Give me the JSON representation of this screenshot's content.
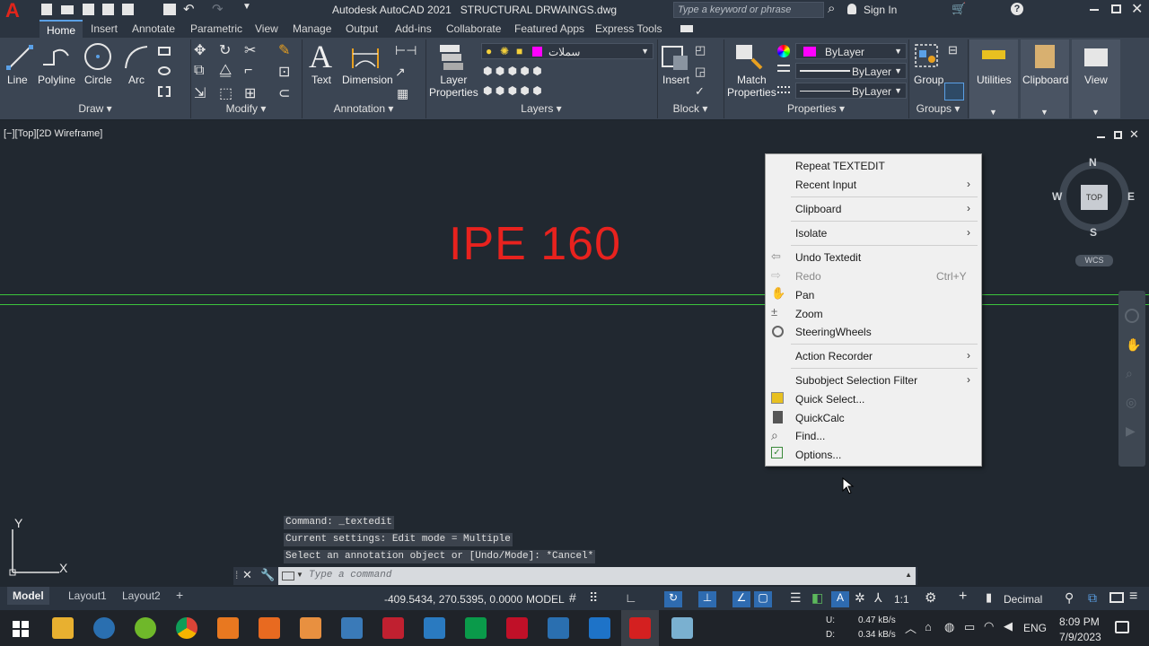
{
  "title": {
    "app": "Autodesk AutoCAD 2021",
    "file": "STRUCTURAL DRWAINGS.dwg",
    "search_placeholder": "Type a keyword or phrase",
    "sign_in": "Sign In"
  },
  "tabs": [
    "Home",
    "Insert",
    "Annotate",
    "Parametric",
    "View",
    "Manage",
    "Output",
    "Add-ins",
    "Collaborate",
    "Featured Apps",
    "Express Tools"
  ],
  "ribbon": {
    "draw": {
      "line": "Line",
      "polyline": "Polyline",
      "circle": "Circle",
      "arc": "Arc",
      "panel": "Draw"
    },
    "modify": {
      "panel": "Modify"
    },
    "annotation": {
      "text": "Text",
      "dimension": "Dimension",
      "panel": "Annotation"
    },
    "layers": {
      "layer_properties": "Layer\nProperties",
      "layer_name": "سملات",
      "panel": "Layers"
    },
    "block": {
      "insert": "Insert",
      "panel": "Block"
    },
    "properties": {
      "match": "Match\nProperties",
      "color": "ByLayer",
      "linetype": "ByLayer",
      "lineweight": "ByLayer",
      "panel": "Properties"
    },
    "groups": {
      "group": "Group",
      "panel": "Groups"
    },
    "utilities": "Utilities",
    "clipboard": "Clipboard",
    "view": "View"
  },
  "viewport": {
    "label": "[−][Top][2D Wireframe]",
    "text": "IPE 160",
    "text_color": "#e8221e"
  },
  "viewcube": {
    "n": "N",
    "s": "S",
    "e": "E",
    "w": "W",
    "top": "TOP",
    "wcs": "WCS"
  },
  "context_menu": [
    {
      "label": "Repeat TEXTEDIT",
      "icon": "",
      "arrow": false
    },
    {
      "label": "Recent Input",
      "icon": "",
      "arrow": true
    },
    {
      "label": "Clipboard",
      "icon": "",
      "arrow": true
    },
    {
      "label": "Isolate",
      "icon": "",
      "arrow": true
    },
    {
      "label": "Undo Textedit",
      "icon": "undo-icon",
      "arrow": false
    },
    {
      "label": "Redo",
      "icon": "redo-icon",
      "arrow": false,
      "shortcut": "Ctrl+Y",
      "disabled": true
    },
    {
      "label": "Pan",
      "icon": "hand-icon",
      "arrow": false
    },
    {
      "label": "Zoom",
      "icon": "zoom-icon",
      "arrow": false
    },
    {
      "label": "SteeringWheels",
      "icon": "wheel-icon",
      "arrow": false
    },
    {
      "label": "Action Recorder",
      "icon": "",
      "arrow": true
    },
    {
      "label": "Subobject Selection Filter",
      "icon": "",
      "arrow": true
    },
    {
      "label": "Quick Select...",
      "icon": "quick-select-icon",
      "arrow": false
    },
    {
      "label": "QuickCalc",
      "icon": "calculator-icon",
      "arrow": false
    },
    {
      "label": "Find...",
      "icon": "find-icon",
      "arrow": false
    },
    {
      "label": "Options...",
      "icon": "options-icon",
      "arrow": false
    }
  ],
  "command": {
    "history": [
      "Command: _textedit",
      "Current settings: Edit mode = Multiple",
      "Select an annotation object or [Undo/Mode]: *Cancel*"
    ],
    "placeholder": "Type a command"
  },
  "status": {
    "tabs": [
      "Model",
      "Layout1",
      "Layout2"
    ],
    "plus": "+",
    "coords": "-409.5434, 270.5395, 0.0000",
    "model": "MODEL",
    "scale": "1:1",
    "units": "Decimal"
  },
  "taskbar": {
    "net_up_label": "U:",
    "net_down_label": "D:",
    "up": "0.47 kB/s",
    "down": "0.34 kB/s",
    "lang": "ENG",
    "time": "8:09 PM",
    "date": "7/9/2023"
  }
}
